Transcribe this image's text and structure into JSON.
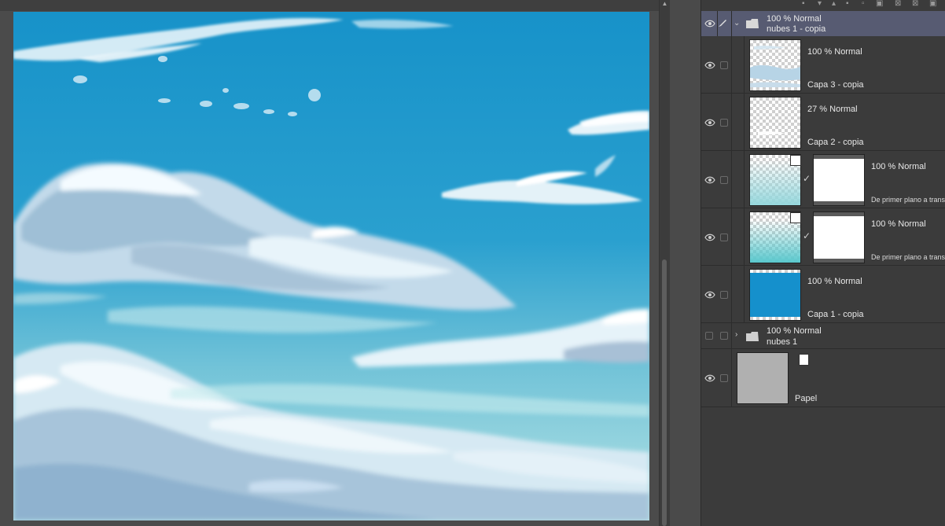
{
  "colors": {
    "sky_top": "#1893cb",
    "sky_bottom": "#a8dfe2",
    "panel_bg": "#3b3b3b",
    "selected_row": "#575b72",
    "paper_gray": "#b0b0b0"
  },
  "layers": [
    {
      "mode": "100 % Normal",
      "name": "nubes 1 - copia",
      "type": "folder",
      "expanded": true,
      "selected": true
    },
    {
      "mode": "100 % Normal",
      "name": "Capa 3 - copia",
      "type": "raster"
    },
    {
      "mode": "27 % Normal",
      "name": "Capa 2 - copia",
      "type": "raster"
    },
    {
      "mode": "100 % Normal",
      "name": "De primer plano a transparente",
      "type": "gradient"
    },
    {
      "mode": "100 % Normal",
      "name": "De primer plano a transparente",
      "type": "gradient"
    },
    {
      "mode": "100 % Normal",
      "name": "Capa 1 - copia",
      "type": "raster"
    },
    {
      "mode": "100 % Normal",
      "name": "nubes 1",
      "type": "folder",
      "expanded": false
    },
    {
      "mode": "",
      "name": "Papel",
      "type": "paper"
    }
  ],
  "icons": {
    "eye": "eye-icon",
    "pen": "pen-icon",
    "folder": "folder-icon",
    "check": "check-icon"
  }
}
